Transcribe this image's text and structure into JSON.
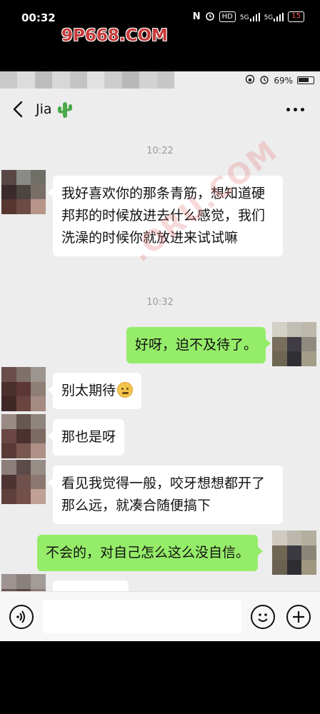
{
  "outer_status": {
    "time": "00:32",
    "nfc": "N",
    "hd": "HD",
    "signal1": "5G",
    "signal2": "5G",
    "battery": "15"
  },
  "watermarks": {
    "top": "9P668.COM",
    "diagonal": ".ORU.COM"
  },
  "inner_status": {
    "battery_percent": "69%"
  },
  "nav": {
    "title": "Jia"
  },
  "timestamps": [
    "10:22",
    "10:32"
  ],
  "messages": [
    {
      "side": "in",
      "text": "我好喜欢你的那条青筋，想知道硬邦邦的时候放进去什么感觉，我们洗澡的时候你就放进来试试嘛"
    },
    {
      "side": "out",
      "text": "好呀，迫不及待了。"
    },
    {
      "side": "in",
      "text": "别太期待",
      "emoji": "grimacing-face"
    },
    {
      "side": "in",
      "text": "那也是呀"
    },
    {
      "side": "in",
      "text": "看见我觉得一般，咬牙想想都开了那么远，就凑合随便搞下"
    },
    {
      "side": "out",
      "text": "不会的，对自己怎么这么没自信。"
    }
  ],
  "input": {
    "value": "",
    "placeholder": ""
  },
  "icons": {
    "back": "chevron-left-icon",
    "title_emoji": "cactus-icon",
    "more": "more-dots-icon",
    "voice": "voice-icon",
    "emoji": "smiley-face-icon",
    "plus": "plus-icon"
  },
  "colors": {
    "chat_bg": "#ededed",
    "incoming_bubble": "#ffffff",
    "outgoing_bubble": "#95ec69",
    "timestamp": "#9a9a9a",
    "watermark": "#c73b3b"
  }
}
